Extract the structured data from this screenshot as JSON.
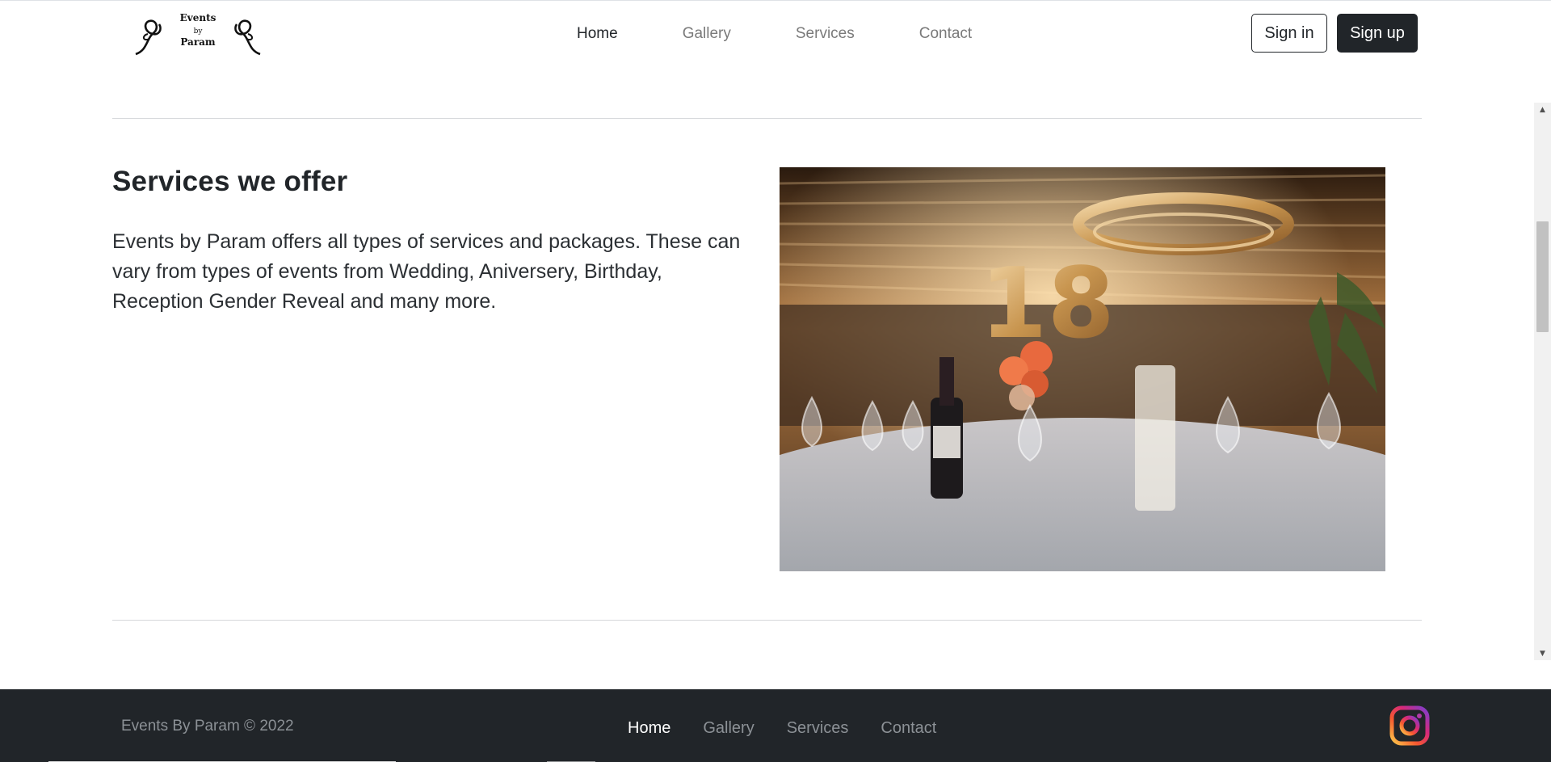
{
  "header": {
    "logo": {
      "line1": "Events",
      "line2": "by",
      "line3": "Param"
    },
    "nav": [
      {
        "label": "Home",
        "active": true
      },
      {
        "label": "Gallery",
        "active": false
      },
      {
        "label": "Services",
        "active": false
      },
      {
        "label": "Contact",
        "active": false
      }
    ],
    "sign_in_label": "Sign in",
    "sign_up_label": "Sign up"
  },
  "main": {
    "title": "Services we offer",
    "description": "Events by Param offers all types of services and packages. These can vary from types of events from Wedding, Aniversery, Birthday, Reception Gender Reveal and many more.",
    "image_icon": "event-table-photo"
  },
  "footer": {
    "copyright": "Events By Param © 2022",
    "nav": [
      {
        "label": "Home",
        "active": true
      },
      {
        "label": "Gallery",
        "active": false
      },
      {
        "label": "Services",
        "active": false
      },
      {
        "label": "Contact",
        "active": false
      }
    ],
    "social_icon": "instagram-icon"
  },
  "colors": {
    "dark": "#212529",
    "muted": "#8c9196",
    "divider": "#d6d8db"
  }
}
